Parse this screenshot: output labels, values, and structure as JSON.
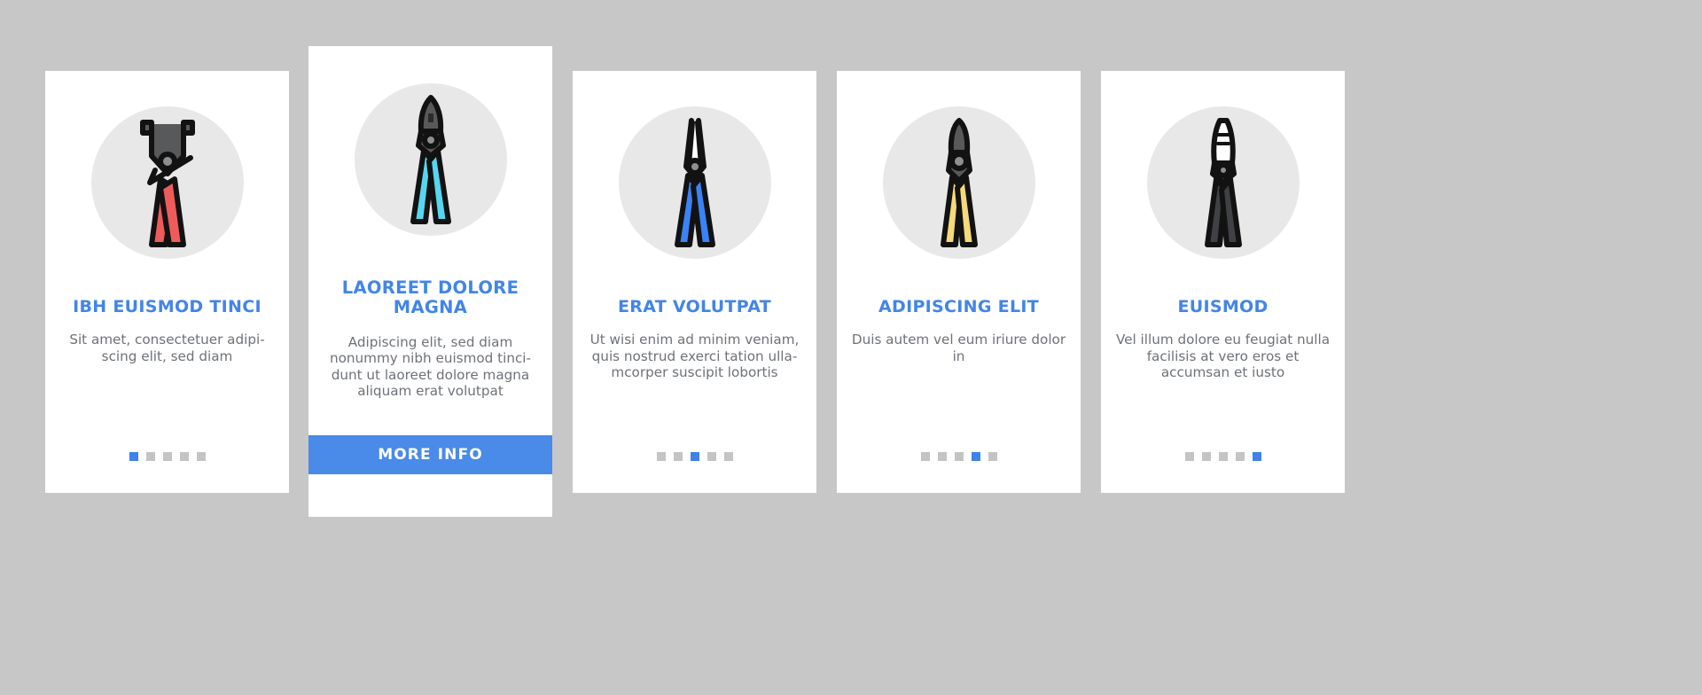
{
  "page": {
    "background_color": "#c7c7c7",
    "card_background": "#ffffff",
    "accent_color": "#4285e8",
    "icon_circle_color": "#e8e8e8",
    "title_color": "#4285e8",
    "body_color": "#6e7278",
    "dot_inactive_color": "#c4c4c4",
    "dot_active_color": "#3e82ea",
    "button_color": "#4a8ae8"
  },
  "cards": [
    {
      "id": "card-1",
      "featured": false,
      "icon": "pliers-red-handles-icon",
      "icon_handle_color": "#ef5b5b",
      "title": "IBH EUISMOD TINCI",
      "description": "Sit amet, consectetuer adipi-scing elit, sed diam",
      "pagination": {
        "count": 5,
        "active_index": 0
      }
    },
    {
      "id": "card-2",
      "featured": true,
      "icon": "diagonal-cutter-cyan-handles-icon",
      "icon_handle_color": "#57d6f0",
      "title": "LAOREET DOLORE MAGNA",
      "description": "Adipiscing elit, sed diam nonummy nibh euismod tinci-dunt ut laoreet dolore magna aliquam erat volutpat",
      "button_label": "MORE INFO"
    },
    {
      "id": "card-3",
      "featured": false,
      "icon": "long-nose-pliers-blue-handles-icon",
      "icon_handle_color": "#3b82f6",
      "title": "ERAT VOLUTPAT",
      "description": "Ut wisi enim ad minim veniam, quis nostrud exerci tation ulla-mcorper suscipit lobortis",
      "pagination": {
        "count": 5,
        "active_index": 2
      }
    },
    {
      "id": "card-4",
      "featured": false,
      "icon": "side-cutter-yellow-handles-icon",
      "icon_handle_color": "#f5d97a",
      "title": "ADIPISCING ELIT",
      "description": "Duis autem vel eum iriure dolor in",
      "pagination": {
        "count": 5,
        "active_index": 3
      }
    },
    {
      "id": "card-5",
      "featured": false,
      "icon": "combination-pliers-black-handles-icon",
      "icon_handle_color": "#3f4145",
      "title": "EUISMOD",
      "description": "Vel illum dolore eu feugiat nulla facilisis at vero eros et accumsan et iusto",
      "pagination": {
        "count": 5,
        "active_index": 4
      }
    }
  ]
}
